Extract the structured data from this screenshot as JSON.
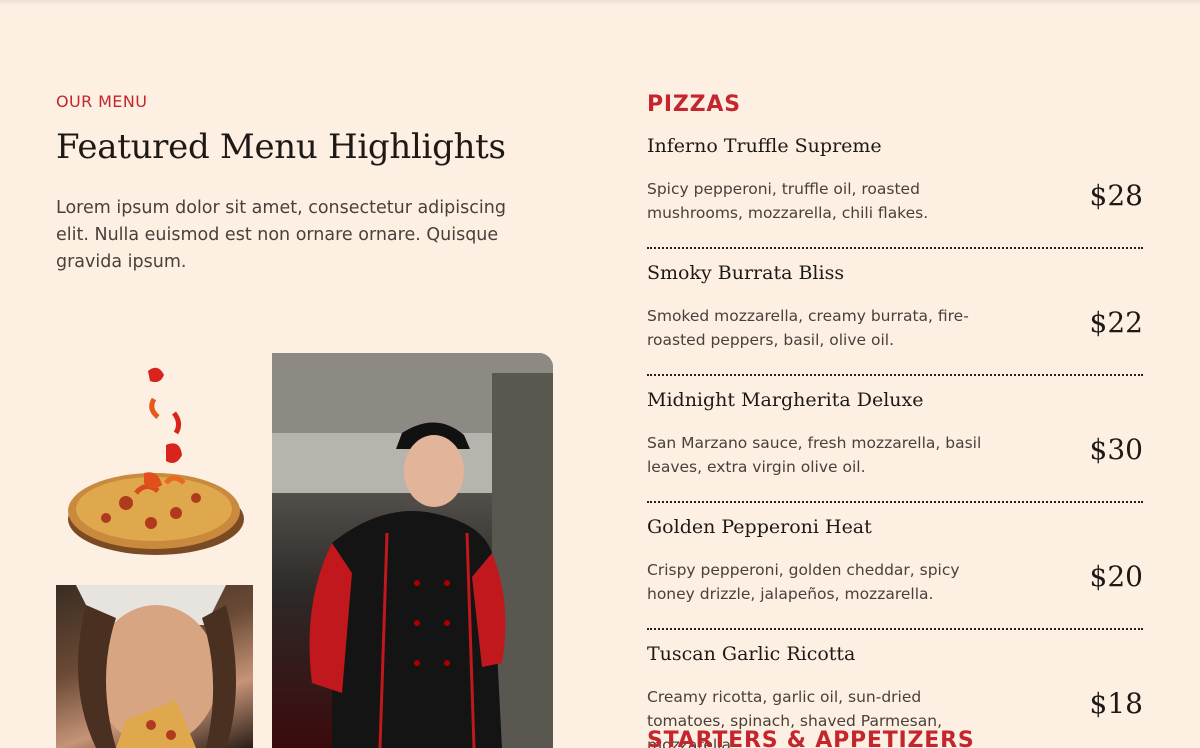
{
  "intro": {
    "eyebrow": "OUR MENU",
    "headline": "Featured Menu Highlights",
    "paragraph": "Lorem ipsum dolor sit amet, consectetur adipiscing elit. Nulla euismod est non ornare ornare. Quisque gravida ipsum."
  },
  "images": {
    "pizza": "pizza-with-peppers-image",
    "chef": "chef-cooking-image",
    "diner": "woman-eating-pizza-image"
  },
  "menu": {
    "pizzas_title": "PIZZAS",
    "items": [
      {
        "name": "Inferno Truffle Supreme",
        "desc": "Spicy pepperoni, truffle oil, roasted mushrooms, mozzarella, chili flakes.",
        "price": "$28"
      },
      {
        "name": "Smoky Burrata Bliss",
        "desc": "Smoked mozzarella, creamy burrata, fire-roasted peppers, basil, olive oil.",
        "price": "$22"
      },
      {
        "name": "Midnight Margherita Deluxe",
        "desc": "San Marzano sauce, fresh mozzarella, basil leaves, extra virgin olive oil.",
        "price": "$30"
      },
      {
        "name": "Golden Pepperoni Heat",
        "desc": "Crispy pepperoni, golden cheddar, spicy honey drizzle, jalapeños, mozzarella.",
        "price": "$20"
      },
      {
        "name": "Tuscan Garlic Ricotta",
        "desc": "Creamy ricotta, garlic oil, sun-dried tomatoes, spinach, shaved Parmesan, mozzarella.",
        "price": "$18"
      }
    ],
    "starters_title": "STARTERS & APPETIZERS"
  },
  "colors": {
    "accent": "#c4262e",
    "background": "#fdefe2",
    "text": "#1f1916"
  }
}
